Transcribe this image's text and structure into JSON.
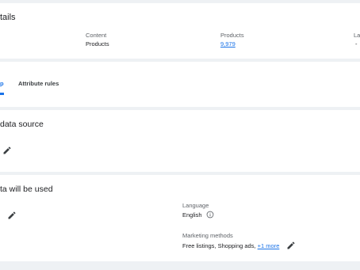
{
  "details": {
    "title": "tails",
    "columns": [
      {
        "label": "Content",
        "value": "Products"
      },
      {
        "label": "Products",
        "value": "9,979"
      },
      {
        "label": "La",
        "value": "-"
      }
    ]
  },
  "tabs": [
    {
      "label": "p",
      "active": true
    },
    {
      "label": "Attribute rules",
      "active": false
    }
  ],
  "source": {
    "title": "data source",
    "edit_icon": "pencil-icon"
  },
  "usage": {
    "title": "ta will be used",
    "edit_icon": "pencil-icon",
    "language": {
      "label": "Language",
      "value": "English",
      "info_icon": "info-icon"
    },
    "marketing": {
      "label": "Marketing methods",
      "value": "Free listings, Shopping ads, ",
      "more_link": "+1 more",
      "edit_icon": "pencil-icon"
    }
  },
  "colors": {
    "accent": "#1a73e8",
    "background": "#eef1f4",
    "card": "#ffffff"
  }
}
